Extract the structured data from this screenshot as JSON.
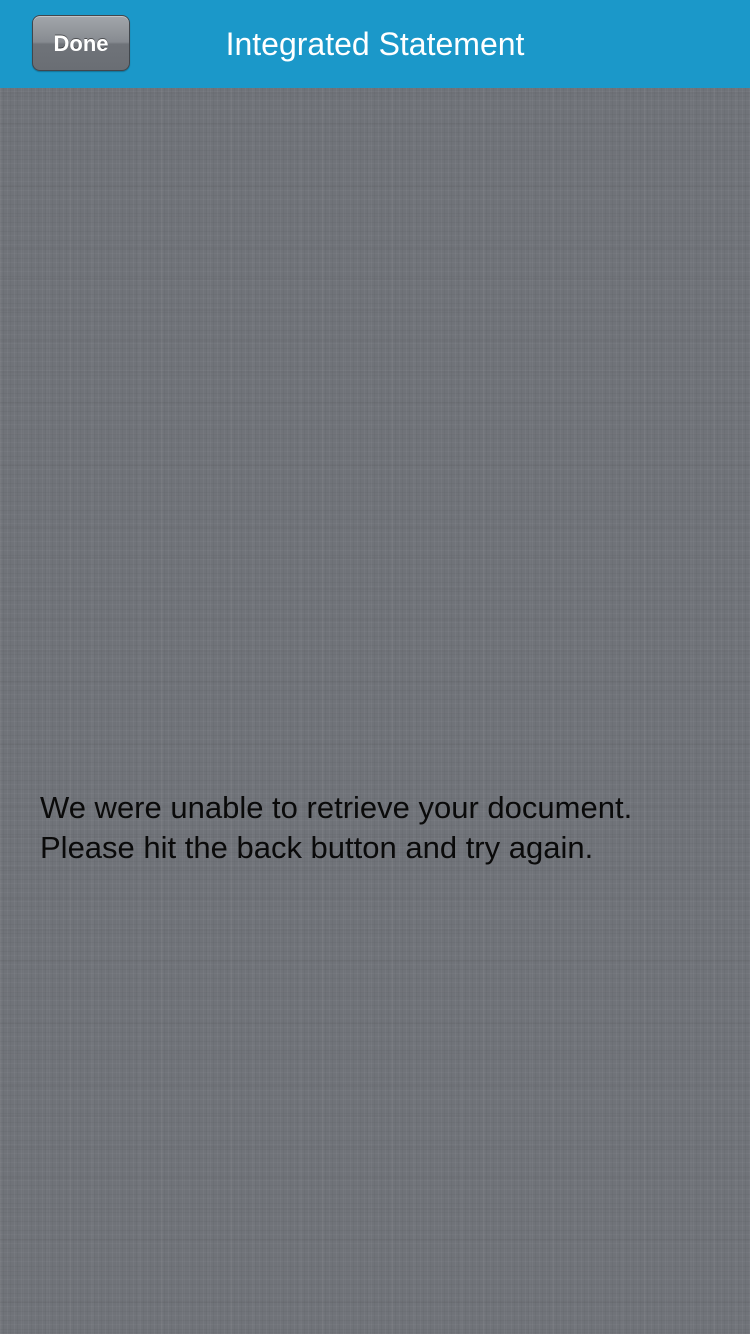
{
  "nav_bar": {
    "done_label": "Done",
    "title": "Integrated Statement",
    "background_color": "#1b98c9"
  },
  "content": {
    "background_color": "#707379",
    "message_lines": [
      "We were unable to retrieve your document.",
      "Please hit the back button and try again."
    ]
  }
}
